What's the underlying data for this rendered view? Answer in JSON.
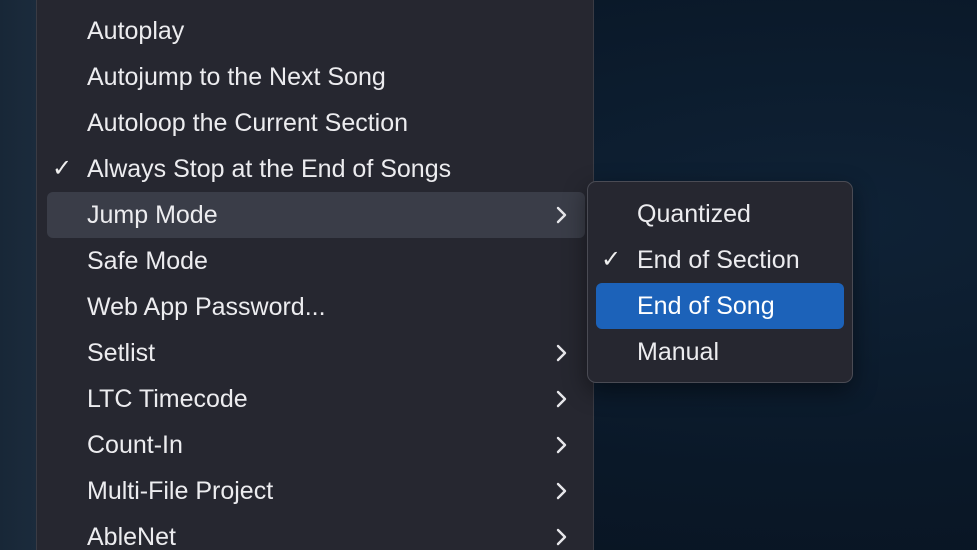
{
  "main_menu": {
    "items": [
      {
        "label": "Autoplay",
        "checked": false,
        "submenu": false
      },
      {
        "label": "Autojump to the Next Song",
        "checked": false,
        "submenu": false
      },
      {
        "label": "Autoloop the Current Section",
        "checked": false,
        "submenu": false
      },
      {
        "label": "Always Stop at the End of Songs",
        "checked": true,
        "submenu": false
      },
      {
        "label": "Jump Mode",
        "checked": false,
        "submenu": true,
        "highlighted": true
      },
      {
        "label": "Safe Mode",
        "checked": false,
        "submenu": false
      },
      {
        "label": "Web App Password...",
        "checked": false,
        "submenu": false
      },
      {
        "label": "Setlist",
        "checked": false,
        "submenu": true
      },
      {
        "label": "LTC Timecode",
        "checked": false,
        "submenu": true
      },
      {
        "label": "Count-In",
        "checked": false,
        "submenu": true
      },
      {
        "label": "Multi-File Project",
        "checked": false,
        "submenu": true
      },
      {
        "label": "AbleNet",
        "checked": false,
        "submenu": true
      }
    ],
    "check_glyph": "✓"
  },
  "jump_mode_submenu": {
    "items": [
      {
        "label": "Quantized",
        "checked": false
      },
      {
        "label": "End of Section",
        "checked": true
      },
      {
        "label": "End of Song",
        "checked": false,
        "selected": true
      },
      {
        "label": "Manual",
        "checked": false
      }
    ],
    "check_glyph": "✓"
  },
  "colors": {
    "menu_bg": "#262730",
    "hover_bg": "#3a3d48",
    "selection_accent": "#1c62b9",
    "desktop_bg": "#0a1828"
  },
  "icons": {
    "checkmark": "checkmark-icon",
    "submenu_arrow": "chevron-right-icon"
  }
}
